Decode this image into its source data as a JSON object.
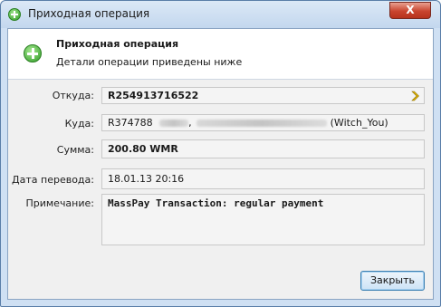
{
  "window": {
    "title": "Приходная операция",
    "close_glyph": "X"
  },
  "header": {
    "title": "Приходная операция",
    "subtitle": "Детали операции приведены ниже",
    "icon": "plus-circle-icon"
  },
  "fields": {
    "from": {
      "label": "Откуда:",
      "value": "R254913716522"
    },
    "to": {
      "label": "Куда:",
      "prefix": "R374788",
      "separator": ",",
      "suffix": "(Witch_You)"
    },
    "amount": {
      "label": "Сумма:",
      "value": "200.80 WMR"
    },
    "date": {
      "label": "Дата перевода:",
      "value": "18.01.13 20:16"
    },
    "note": {
      "label": "Примечание:",
      "value": "MassPay Transaction: regular payment"
    }
  },
  "buttons": {
    "close_label": "Закрыть"
  },
  "colors": {
    "accent_green": "#2f9c25",
    "titlebar": "#c3d7ee",
    "close_red": "#c9452e",
    "arrow_yellow": "#e6b800"
  }
}
